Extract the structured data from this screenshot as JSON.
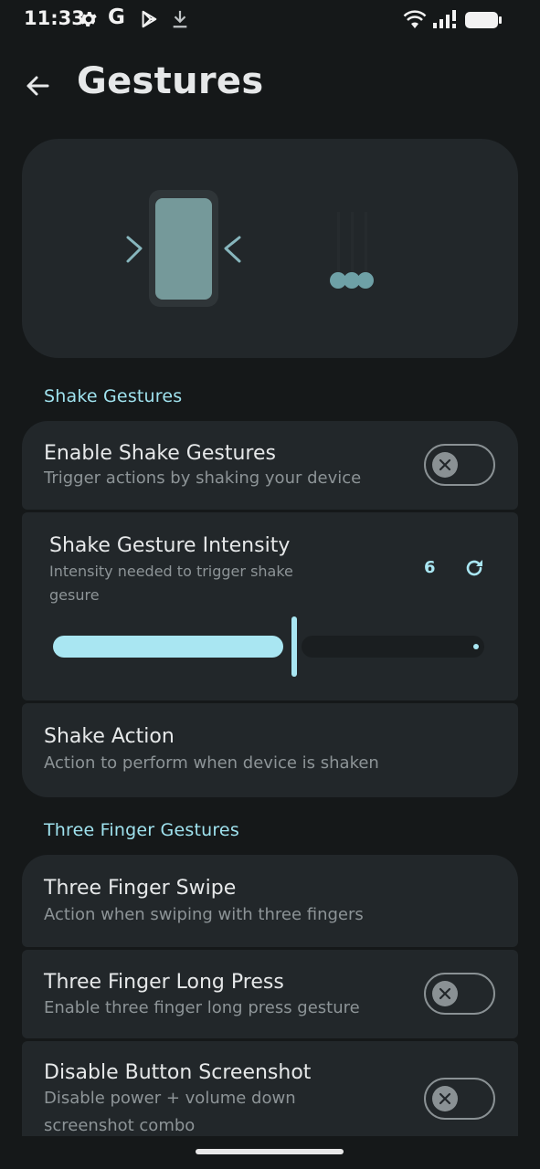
{
  "status_bar": {
    "time": "11:33",
    "icons": [
      "gear-icon",
      "google-g-icon",
      "play-store-icon",
      "download-icon",
      "wifi-icon",
      "signal-icon",
      "battery-icon"
    ],
    "google_letter": "G"
  },
  "header": {
    "title": "Gestures"
  },
  "sections": {
    "shake": {
      "title": "Shake Gestures",
      "enable": {
        "title": "Enable Shake Gestures",
        "subtitle": "Trigger actions by shaking your device",
        "enabled": false
      },
      "intensity": {
        "title": "Shake Gesture Intensity",
        "subtitle_line1": "Intensity needed to trigger shake",
        "subtitle_line2": "gesure",
        "value": "6",
        "slider_fraction": 0.55
      },
      "action": {
        "title": "Shake Action",
        "subtitle": "Action to perform when device is shaken"
      }
    },
    "three_finger": {
      "title": "Three Finger Gestures",
      "swipe": {
        "title": "Three Finger Swipe",
        "subtitle": "Action when swiping with three fingers"
      },
      "long_press": {
        "title": "Three Finger Long Press",
        "subtitle": "Enable three finger long press gesture",
        "enabled": false
      },
      "disable_screenshot": {
        "title": "Disable Button Screenshot",
        "subtitle_line1": "Disable power + volume down",
        "subtitle_line2": "screenshot combo",
        "enabled": false
      }
    }
  },
  "colors": {
    "background": "#151819",
    "card": "#22272a",
    "accent": "#a9e6f2",
    "section_title": "#9fe2ee",
    "muted_text": "#8d9497"
  }
}
